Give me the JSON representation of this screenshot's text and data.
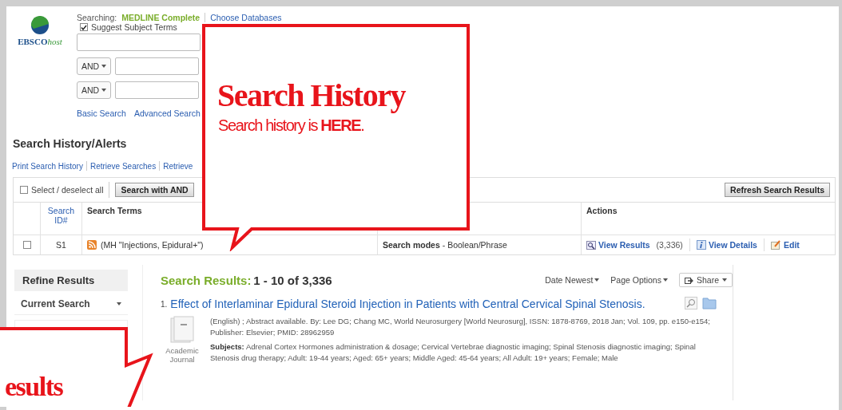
{
  "logo": {
    "brand": "EBSCO",
    "suffix": "host"
  },
  "search_form": {
    "searching_label": "Searching:",
    "database": "MEDLINE Complete",
    "choose_databases": "Choose Databases",
    "suggest_terms": {
      "label": "Suggest Subject Terms",
      "checked": true
    },
    "rows": [
      {},
      {
        "operator": "AND"
      },
      {
        "operator": "AND"
      }
    ],
    "links": [
      "Basic Search",
      "Advanced Search"
    ]
  },
  "history": {
    "title": "Search History/Alerts",
    "links": [
      {
        "label": "Print Search History",
        "disabled": false
      },
      {
        "label": "Retrieve Searches",
        "disabled": false
      },
      {
        "label": "Retrieve",
        "disabled": false
      }
    ],
    "select_all": {
      "label": "Select / deselect all",
      "checked": false
    },
    "buttons": [
      {
        "label": "Search with AND",
        "disabled": false
      }
    ],
    "refresh": "Refresh Search Results",
    "columns": [
      "Search ID#",
      "Search Terms"
    ],
    "actions_column": "Actions",
    "rows": [
      {
        "checked": false,
        "id": "S1",
        "terms": "(MH \"Injections, Epidural+\")",
        "options": "**Search modes** - Boolean/Phrase",
        "actions": [
          {
            "kind": "results",
            "label": "View Results",
            "count": "(3,336)"
          },
          {
            "kind": "details",
            "label": "View Details"
          },
          {
            "kind": "edit",
            "label": "Edit"
          }
        ]
      }
    ]
  },
  "sidebar": {
    "title": "Refine Results",
    "section": "Current Search"
  },
  "results": {
    "label": "Search Results:",
    "range": "1 - 10 of 3,336",
    "sort": "Date Newest",
    "page_options": "Page Options",
    "share": "Share",
    "items": [
      {
        "number": "1.",
        "title": "Effect of Interlaminar Epidural Steroid Injection in Patients with Central Cervical Spinal Stenosis.",
        "type": "Academic Journal",
        "citation": "(English) ; Abstract available. By: Lee DG; Chang MC, World Neurosurgery [World Neurosurg], ISSN: 1878-8769, 2018 Jan; Vol. 109, pp. e150-e154; Publisher: Elsevier; PMID: 28962959",
        "subjects": "**Subjects:** Adrenal Cortex Hormones administration & dosage; Cervical Vertebrae diagnostic imaging; Spinal Stenosis diagnostic imaging; Spinal Stenosis drug therapy; Adult: 19-44 years; Aged: 65+ years; Middle Aged: 45-64 years; All Adult: 19+ years; Female; Male"
      }
    ]
  },
  "annotations": [
    {
      "kind": "history",
      "title": "Search History",
      "text": "Search history is **HERE**."
    },
    {
      "kind": "results",
      "title": "esults"
    }
  ]
}
